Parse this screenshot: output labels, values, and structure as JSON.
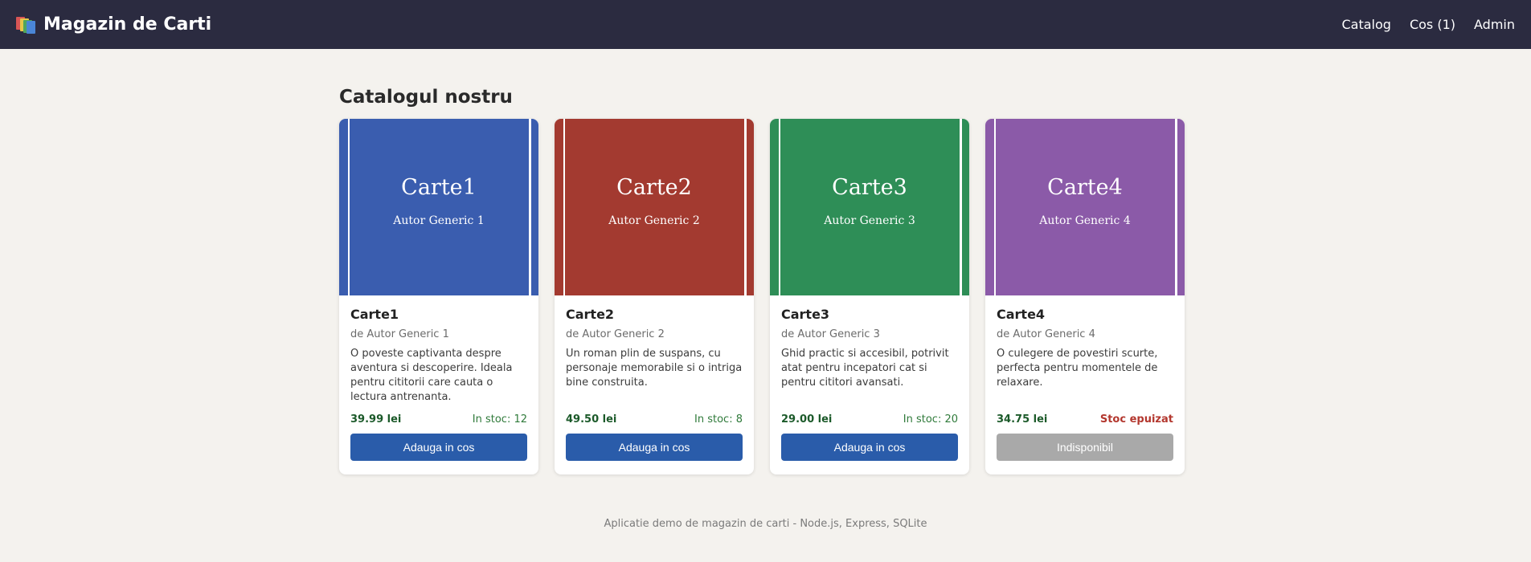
{
  "header": {
    "brand": "Magazin de Carti",
    "nav": [
      "Catalog",
      "Cos (1)",
      "Admin"
    ]
  },
  "main": {
    "title": "Catalogul nostru"
  },
  "books": [
    {
      "cover_title": "Carte1",
      "cover_author": "Autor Generic 1",
      "title": "Carte1",
      "author": "de Autor Generic 1",
      "description": "O poveste captivanta despre aventura si descoperire. Ideala pentru cititorii care cauta o lectura antrenanta.",
      "price": "39.99 lei",
      "stock": "In stoc: 12",
      "button": "Adauga in cos",
      "color": "#3a5daf",
      "available": true
    },
    {
      "cover_title": "Carte2",
      "cover_author": "Autor Generic 2",
      "title": "Carte2",
      "author": "de Autor Generic 2",
      "description": "Un roman plin de suspans, cu personaje memorabile si o intriga bine construita.",
      "price": "49.50 lei",
      "stock": "In stoc: 8",
      "button": "Adauga in cos",
      "color": "#a33a30",
      "available": true
    },
    {
      "cover_title": "Carte3",
      "cover_author": "Autor Generic 3",
      "title": "Carte3",
      "author": "de Autor Generic 3",
      "description": "Ghid practic si accesibil, potrivit atat pentru incepatori cat si pentru cititori avansati.",
      "price": "29.00 lei",
      "stock": "In stoc: 20",
      "button": "Adauga in cos",
      "color": "#2e8e57",
      "available": true
    },
    {
      "cover_title": "Carte4",
      "cover_author": "Autor Generic 4",
      "title": "Carte4",
      "author": "de Autor Generic 4",
      "description": "O culegere de povestiri scurte, perfecta pentru momentele de relaxare.",
      "price": "34.75 lei",
      "stock": "Stoc epuizat",
      "button": "Indisponibil",
      "color": "#8b5aa8",
      "available": false
    }
  ],
  "footer": {
    "text": "Aplicatie demo de magazin de carti - Node.js, Express, SQLite"
  }
}
